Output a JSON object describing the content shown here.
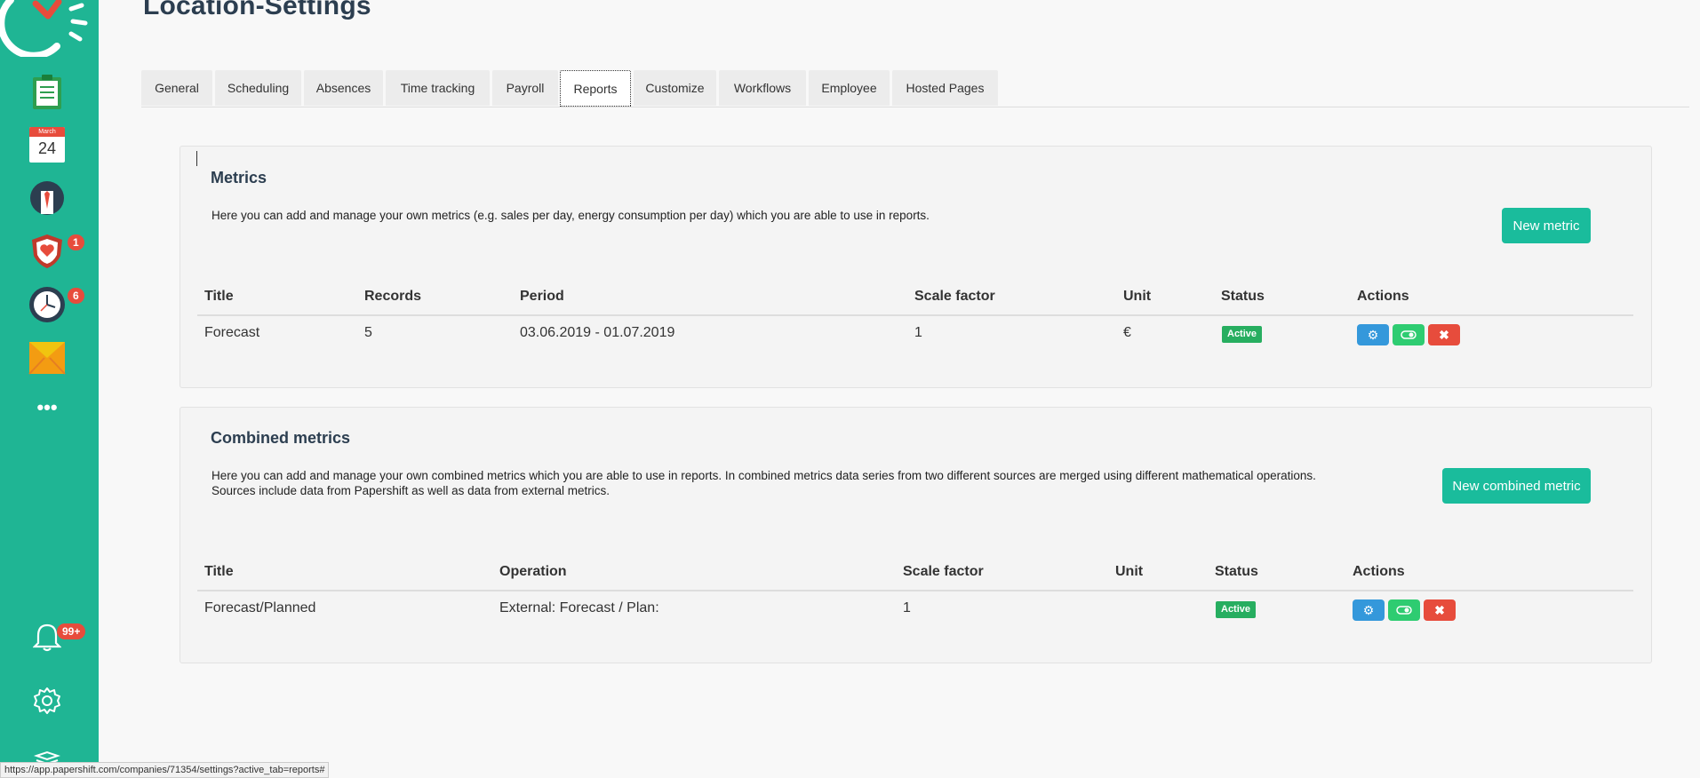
{
  "page": {
    "title": "Location-Settings"
  },
  "tabs": [
    {
      "label": "General"
    },
    {
      "label": "Scheduling"
    },
    {
      "label": "Absences"
    },
    {
      "label": "Time tracking"
    },
    {
      "label": "Payroll"
    },
    {
      "label": "Reports"
    },
    {
      "label": "Customize"
    },
    {
      "label": "Workflows"
    },
    {
      "label": "Employee"
    },
    {
      "label": "Hosted Pages"
    }
  ],
  "active_tab": "Reports",
  "sidebar": {
    "calendar_month": "March",
    "calendar_day": "24",
    "absences_badge": "1",
    "timetracking_badge": "6",
    "notifications_badge": "99+"
  },
  "metrics": {
    "title": "Metrics",
    "description": "Here you can add and manage your own metrics (e.g. sales per day, energy consumption per day) which you are able to use in reports.",
    "new_button": "New metric",
    "headers": {
      "title": "Title",
      "records": "Records",
      "period": "Period",
      "scale": "Scale factor",
      "unit": "Unit",
      "status": "Status",
      "actions": "Actions"
    },
    "rows": [
      {
        "title": "Forecast",
        "records": "5",
        "period": "03.06.2019 - 01.07.2019",
        "scale": "1",
        "unit": "€",
        "status": "Active"
      }
    ]
  },
  "combined": {
    "title": "Combined metrics",
    "description_1": "Here you can add and manage your own combined metrics which you are able to use in reports. In combined metrics data series from two different sources are merged using different mathematical operations.",
    "description_2": "Sources include data from Papershift as well as data from external metrics.",
    "new_button": "New combined metric",
    "headers": {
      "title": "Title",
      "operation": "Operation",
      "scale": "Scale factor",
      "unit": "Unit",
      "status": "Status",
      "actions": "Actions"
    },
    "rows": [
      {
        "title": "Forecast/Planned",
        "operation": "External: Forecast / Plan:",
        "scale": "1",
        "unit": "",
        "status": "Active"
      }
    ]
  },
  "status_bar": {
    "url": "https://app.papershift.com/companies/71354/settings?active_tab=reports#"
  },
  "colors": {
    "brand": "#1fb594",
    "button": "#1abc9c",
    "active": "#27ae60",
    "edit": "#3498db",
    "toggle": "#2ecc71",
    "delete": "#e74c3c"
  }
}
